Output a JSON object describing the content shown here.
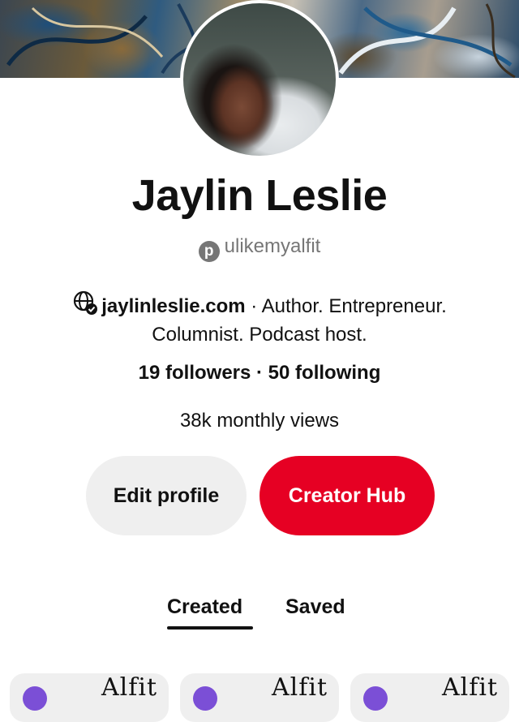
{
  "profile": {
    "name": "Jaylin Leslie",
    "handle": "ulikemyalfit",
    "website": "jaylinleslie.com",
    "bio_line1": "· Author. Entrepreneur.",
    "bio_line2": "Columnist. Podcast host.",
    "stats": "19 followers · 50 following",
    "monthly_views": "38k monthly views"
  },
  "actions": {
    "edit_profile": "Edit profile",
    "creator_hub": "Creator Hub"
  },
  "tabs": [
    {
      "label": "Created",
      "active": true
    },
    {
      "label": "Saved",
      "active": false
    }
  ],
  "cards": [
    {
      "text": "Alfit"
    },
    {
      "text": "Alfit"
    },
    {
      "text": "Alfit"
    }
  ],
  "colors": {
    "accent": "#e60023",
    "secondary_button": "#efefef",
    "muted_text": "#767676"
  },
  "icons": [
    "pinterest-icon",
    "globe-verified-icon"
  ]
}
